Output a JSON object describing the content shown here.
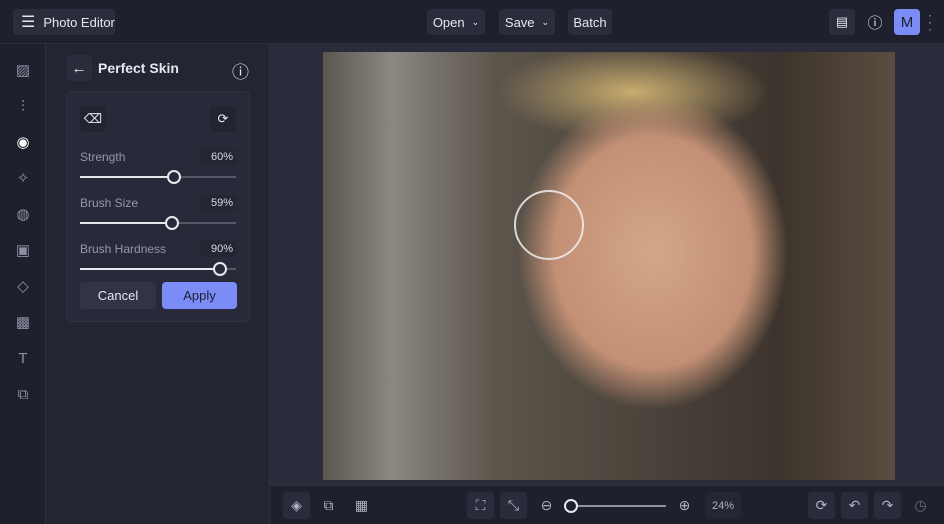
{
  "header": {
    "app_title": "Photo Editor",
    "open_label": "Open",
    "save_label": "Save",
    "batch_label": "Batch",
    "avatar_initial": "M"
  },
  "panel": {
    "title": "Perfect Skin",
    "sliders": [
      {
        "label": "Strength",
        "value": "60%",
        "fraction": 0.6
      },
      {
        "label": "Brush Size",
        "value": "59%",
        "fraction": 0.59
      },
      {
        "label": "Brush Hardness",
        "value": "90%",
        "fraction": 0.9
      }
    ],
    "cancel_label": "Cancel",
    "apply_label": "Apply"
  },
  "footer": {
    "zoom_value": "24%",
    "zoom_fraction": 0.0
  },
  "colors": {
    "accent": "#7b8cf7"
  }
}
